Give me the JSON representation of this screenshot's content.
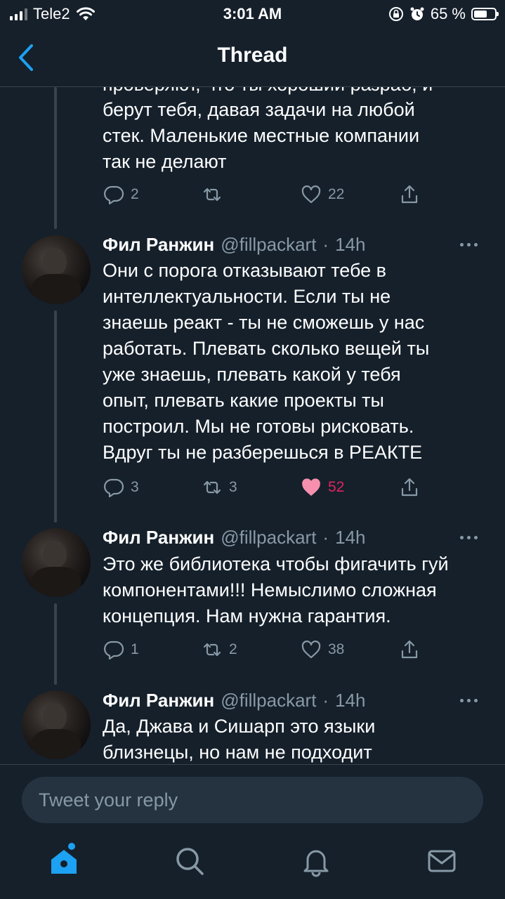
{
  "status_bar": {
    "carrier": "Tele2",
    "time": "3:01 AM",
    "battery_text": "65 %",
    "battery_level": 0.65
  },
  "header": {
    "title": "Thread"
  },
  "tweets": [
    {
      "partial_text_top": "проверяют, что ты хороший разраб, и",
      "text": "берут тебя, давая задачи на любой\nстек. Маленькие местные компании\nтак не делают",
      "replies": "2",
      "retweets": "",
      "likes": "22",
      "liked": false
    },
    {
      "name": "Фил Ранжин",
      "handle": "@fillpackart",
      "time": "14h",
      "text": "Они с порога отказывают тебе в\nинтеллектуальности. Если ты не\nзнаешь реакт - ты не сможешь у нас\nработать. Плевать сколько вещей ты\nуже знаешь, плевать какой у тебя\nопыт, плевать какие проекты ты\nпостроил. Мы не готовы рисковать.\nВдруг ты не разберешься в РЕАКТЕ",
      "replies": "3",
      "retweets": "3",
      "likes": "52",
      "liked": true
    },
    {
      "name": "Фил Ранжин",
      "handle": "@fillpackart",
      "time": "14h",
      "text": "Это же библиотека чтобы фигачить гуй\nкомпонентами!!! Немыслимо сложная\nконцепция. Нам нужна гарантия.",
      "replies": "1",
      "retweets": "2",
      "likes": "38",
      "liked": false
    },
    {
      "name": "Фил Ранжин",
      "handle": "@fillpackart",
      "time": "14h",
      "text": "Да, Джава и Сишарп это языки\nблизнецы, но нам не подходит"
    }
  ],
  "reply": {
    "placeholder": "Tweet your reply"
  },
  "tabs": [
    {
      "icon": "home-icon",
      "active": true
    },
    {
      "icon": "search-icon",
      "active": false
    },
    {
      "icon": "bell-icon",
      "active": false
    },
    {
      "icon": "mail-icon",
      "active": false
    }
  ],
  "colors": {
    "background": "#15202b",
    "secondary_text": "#8899a6",
    "accent": "#1da1f2",
    "like": "#e0245e",
    "divider": "#38444d"
  }
}
